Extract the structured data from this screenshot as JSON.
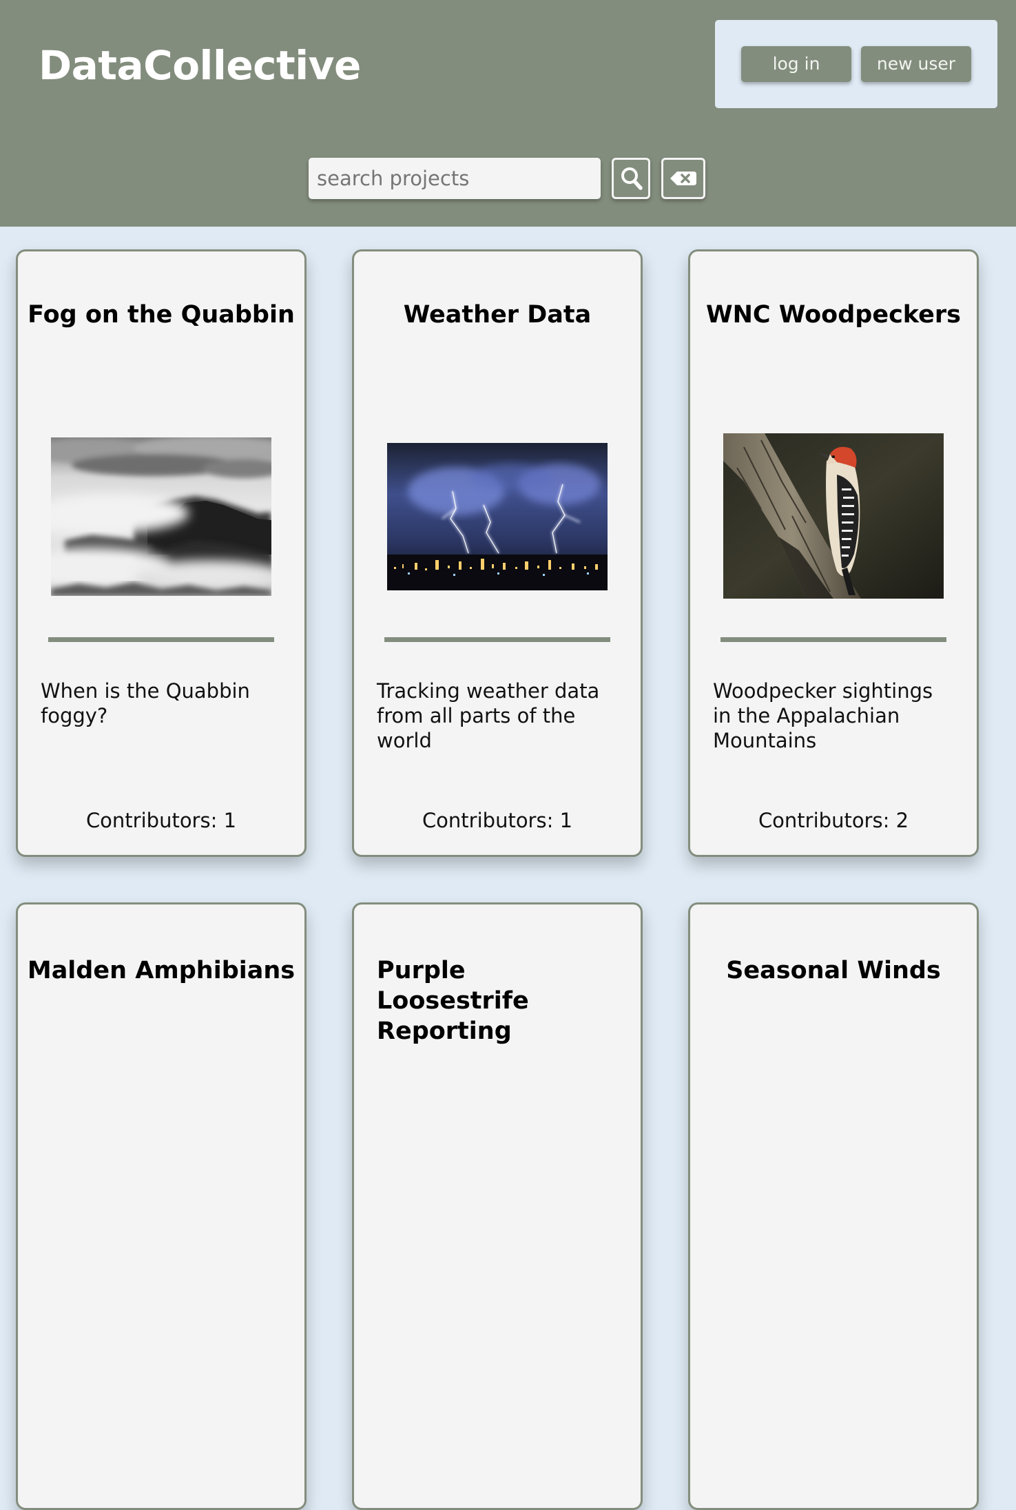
{
  "header": {
    "logo": "DataCollective",
    "login_label": "log in",
    "newuser_label": "new user",
    "search_placeholder": "search projects",
    "search_icon": "magnifier-icon",
    "clear_icon": "backspace-icon"
  },
  "colors": {
    "header_bg": "#838d7d",
    "page_bg": "#dfeaf4",
    "card_bg": "#f4f4f4",
    "accent": "#838d7d"
  },
  "projects": [
    {
      "title": "Fog on the Quabbin",
      "image": "foggy-forest-photo",
      "description": "When is the Quabbin foggy?",
      "contributors": "Contributors: 1"
    },
    {
      "title": "Weather Data",
      "image": "lightning-city-photo",
      "description": "Tracking weather data from all parts of the world",
      "contributors": "Contributors: 1"
    },
    {
      "title": "WNC Woodpeckers",
      "image": "woodpecker-photo",
      "description": "Woodpecker sightings in the Appalachian Mountains",
      "contributors": "Contributors: 2"
    },
    {
      "title": "Malden Amphibians"
    },
    {
      "title": "Purple Loosestrife Reporting"
    },
    {
      "title": "Seasonal Winds"
    }
  ]
}
